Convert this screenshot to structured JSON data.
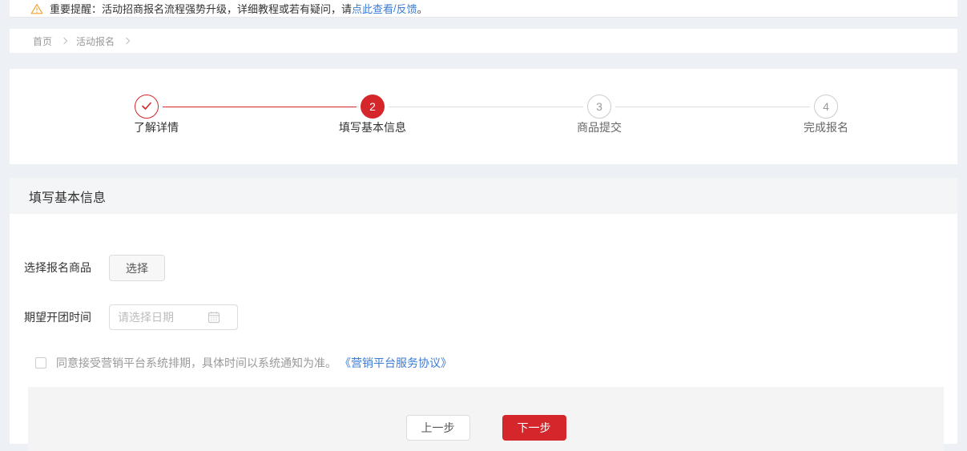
{
  "alert": {
    "text_prefix": "重要提醒：活动招商报名流程强势升级，详细教程或若有疑问，请",
    "link_view": "点此查看",
    "link_sep": "/",
    "link_feedback": "反馈",
    "text_suffix": "。"
  },
  "breadcrumb": {
    "home": "首页",
    "activity": "活动报名"
  },
  "stepper": {
    "steps": [
      {
        "label": "了解详情",
        "number": "",
        "state": "done"
      },
      {
        "label": "填写基本信息",
        "number": "2",
        "state": "active"
      },
      {
        "label": "商品提交",
        "number": "3",
        "state": "pending"
      },
      {
        "label": "完成报名",
        "number": "4",
        "state": "pending"
      }
    ]
  },
  "form": {
    "section_title": "填写基本信息",
    "product_label": "选择报名商品",
    "select_button": "选择",
    "date_label": "期望开团时间",
    "date_placeholder": "请选择日期",
    "agreement_text": "同意接受营销平台系统排期，具体时间以系统通知为准。",
    "agreement_link": "《营销平台服务协议》",
    "prev_button": "上一步",
    "next_button": "下一步"
  },
  "colors": {
    "accent_red": "#d5262b",
    "link_blue": "#3a7bd5",
    "warning_orange": "#f0a32f",
    "page_bg": "#edf0f5"
  }
}
